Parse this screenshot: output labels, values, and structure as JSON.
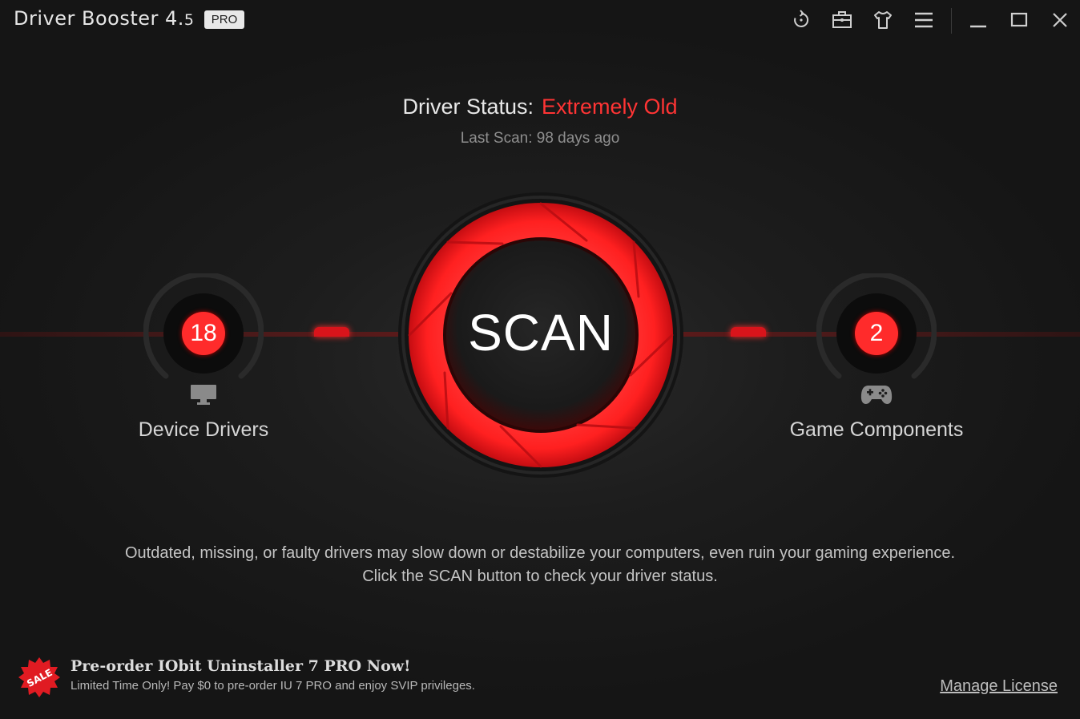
{
  "app": {
    "title_main": "Driver Booster 4.",
    "title_sub": "5",
    "badge": "PRO"
  },
  "toolbar": {
    "icons": [
      "restore-icon",
      "toolbox-icon",
      "skin-icon",
      "menu-icon",
      "minimize-icon",
      "maximize-icon",
      "close-icon"
    ]
  },
  "status": {
    "label": "Driver Status:",
    "value": "Extremely Old",
    "value_color": "#ff3434",
    "last_scan": "Last Scan: 98 days ago"
  },
  "scan": {
    "label": "SCAN",
    "accent": "#ff2b2b"
  },
  "device_drivers": {
    "count": "18",
    "label": "Device Drivers",
    "icon": "monitor-icon"
  },
  "game_components": {
    "count": "2",
    "label": "Game Components",
    "icon": "gamepad-icon"
  },
  "description": "Outdated, missing, or faulty drivers may slow down or destabilize your computers, even ruin your gaming experience. Click the SCAN button to check your driver status.",
  "promo": {
    "badge_text": "SALE",
    "title": "Pre-order IObit Uninstaller 7 PRO Now!",
    "subtitle": "Limited Time Only! Pay $0 to pre-order IU 7 PRO and enjoy SVIP privileges."
  },
  "footer": {
    "manage_license": "Manage License"
  }
}
